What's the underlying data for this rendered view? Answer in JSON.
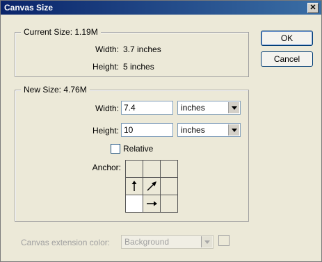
{
  "window": {
    "title": "Canvas Size",
    "close_glyph": "✕"
  },
  "current_size": {
    "legend": "Current Size: 1.19M",
    "width_label": "Width:",
    "width_value": "3.7 inches",
    "height_label": "Height:",
    "height_value": "5 inches"
  },
  "new_size": {
    "legend": "New Size: 4.76M",
    "width_label": "Width:",
    "width_value": "7.4",
    "width_unit": "inches",
    "height_label": "Height:",
    "height_value": "10",
    "height_unit": "inches",
    "relative_label": "Relative",
    "relative_checked": false,
    "anchor_label": "Anchor:",
    "anchor_selected": "bottom-left",
    "anchor_arrows": {
      "middle-left": "arrow-up-icon",
      "center": "arrow-up-right-icon",
      "bottom-center": "arrow-right-icon"
    }
  },
  "buttons": {
    "ok": "OK",
    "cancel": "Cancel"
  },
  "extension": {
    "label": "Canvas extension color:",
    "value": "Background",
    "enabled": false
  },
  "colors": {
    "titlebar_start": "#0a246a",
    "titlebar_end": "#3a6ea5",
    "dialog_bg": "#ece9d8"
  }
}
